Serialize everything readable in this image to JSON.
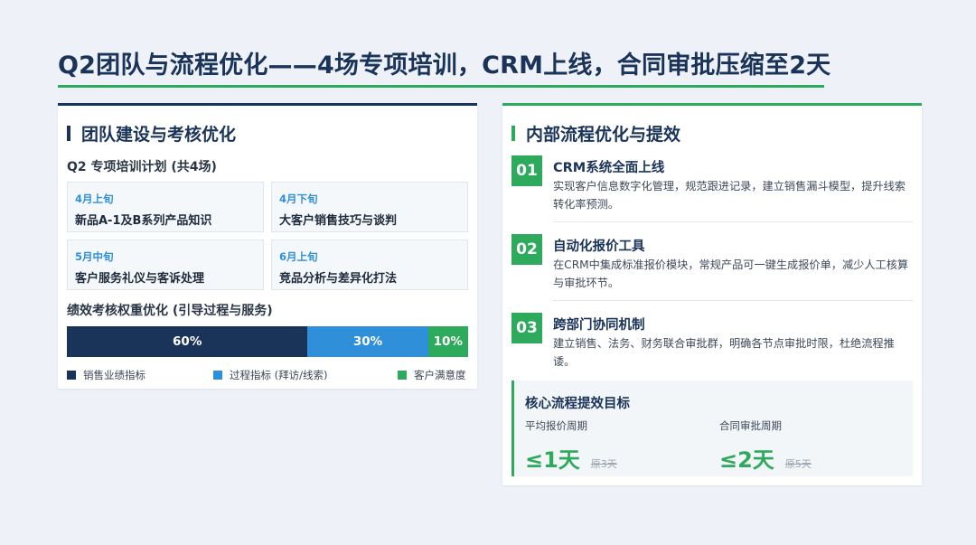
{
  "title": "Q2团队与流程优化——4场专项培训，CRM上线，合同审批压缩至2天",
  "colors": {
    "navy": "#1a3358",
    "green": "#2eaa5c",
    "blue": "#2f8fd8"
  },
  "left_card": {
    "heading": "团队建设与考核优化",
    "training_label": "Q2 专项培训计划 (共4场)",
    "trainings": [
      {
        "when": "4月上旬",
        "topic": "新品A-1及B系列产品知识"
      },
      {
        "when": "4月下旬",
        "topic": "大客户销售技巧与谈判"
      },
      {
        "when": "5月中旬",
        "topic": "客户服务礼仪与客诉处理"
      },
      {
        "when": "6月上旬",
        "topic": "竞品分析与差异化打法"
      }
    ],
    "weights_label": "绩效考核权重优化 (引导过程与服务)",
    "chart_data": {
      "type": "bar",
      "stacked": true,
      "orientation": "horizontal",
      "series": [
        {
          "name": "销售业绩指标",
          "value": 60,
          "label": "60%",
          "color": "#1a3358"
        },
        {
          "name": "过程指标 (拜访/线索)",
          "value": 30,
          "label": "30%",
          "color": "#2f8fd8"
        },
        {
          "name": "客户满意度",
          "value": 10,
          "label": "10%",
          "color": "#2eaa5c"
        }
      ],
      "legend_position": "bottom"
    }
  },
  "right_card": {
    "heading": "内部流程优化与提效",
    "steps": [
      {
        "num": "01",
        "title": "CRM系统全面上线",
        "desc": "实现客户信息数字化管理，规范跟进记录，建立销售漏斗模型，提升线索转化率预测。"
      },
      {
        "num": "02",
        "title": "自动化报价工具",
        "desc": "在CRM中集成标准报价模块，常规产品可一键生成报价单，减少人工核算与审批环节。"
      },
      {
        "num": "03",
        "title": "跨部门协同机制",
        "desc": "建立销售、法务、财务联合审批群，明确各节点审批时限，杜绝流程推诿。"
      }
    ],
    "goals": {
      "title": "核心流程提效目标",
      "items": [
        {
          "label": "平均报价周期",
          "value": "≤1天",
          "old": "原3天"
        },
        {
          "label": "合同审批周期",
          "value": "≤2天",
          "old": "原5天"
        }
      ]
    }
  }
}
